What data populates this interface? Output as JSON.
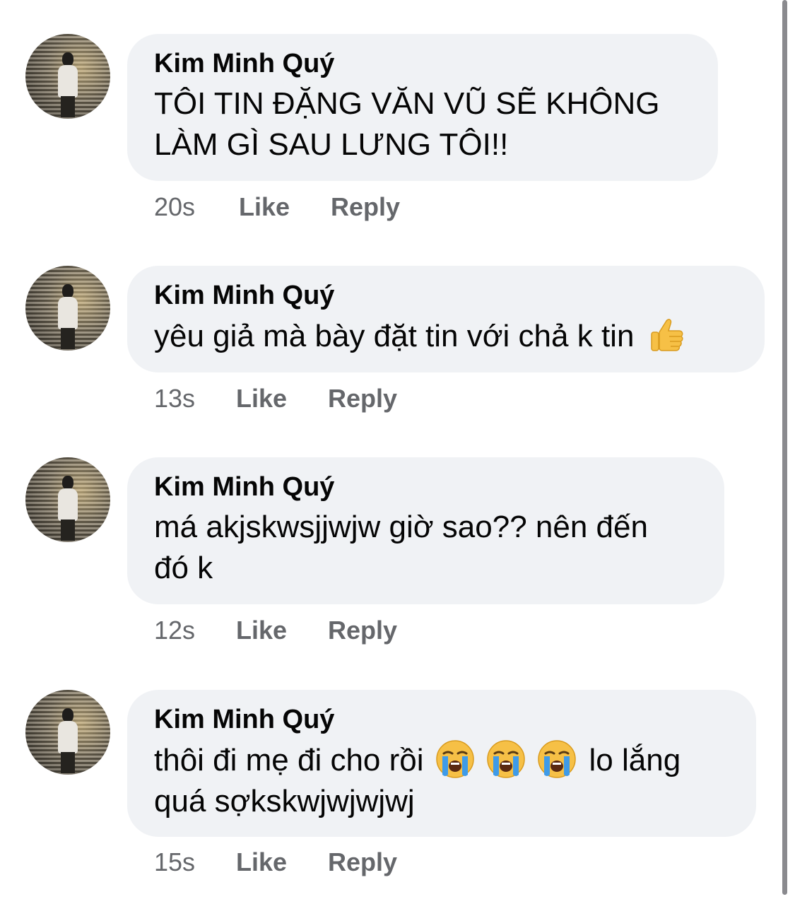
{
  "comments": [
    {
      "author": "Kim Minh Quý",
      "text": "TÔI TIN ĐẶNG VĂN VŨ SẼ KHÔNG LÀM GÌ SAU LƯNG TÔI!!",
      "time": "20s",
      "like": "Like",
      "reply": "Reply"
    },
    {
      "author": "Kim Minh Quý",
      "text": "yêu giả mà bày đặt tin với chả k tin",
      "emoji": "thumbs-up-emoji",
      "time": "13s",
      "like": "Like",
      "reply": "Reply"
    },
    {
      "author": "Kim Minh Quý",
      "text_line1": "má akjskwsjjwjw giờ sao?? nên đến",
      "text_line2": "đó k",
      "time": "12s",
      "like": "Like",
      "reply": "Reply"
    },
    {
      "author": "Kim Minh Quý",
      "text_before": "thôi đi mẹ đi cho rồi",
      "emoji": "loudly-crying-face-emoji",
      "text_after": "lo lắng",
      "text_line2": "quá sợkskwjwjwjwj",
      "time": "15s",
      "like": "Like",
      "reply": "Reply"
    }
  ],
  "colors": {
    "bubble_bg": "#f0f2f5",
    "text": "#050505",
    "secondary_text": "#65676b"
  }
}
